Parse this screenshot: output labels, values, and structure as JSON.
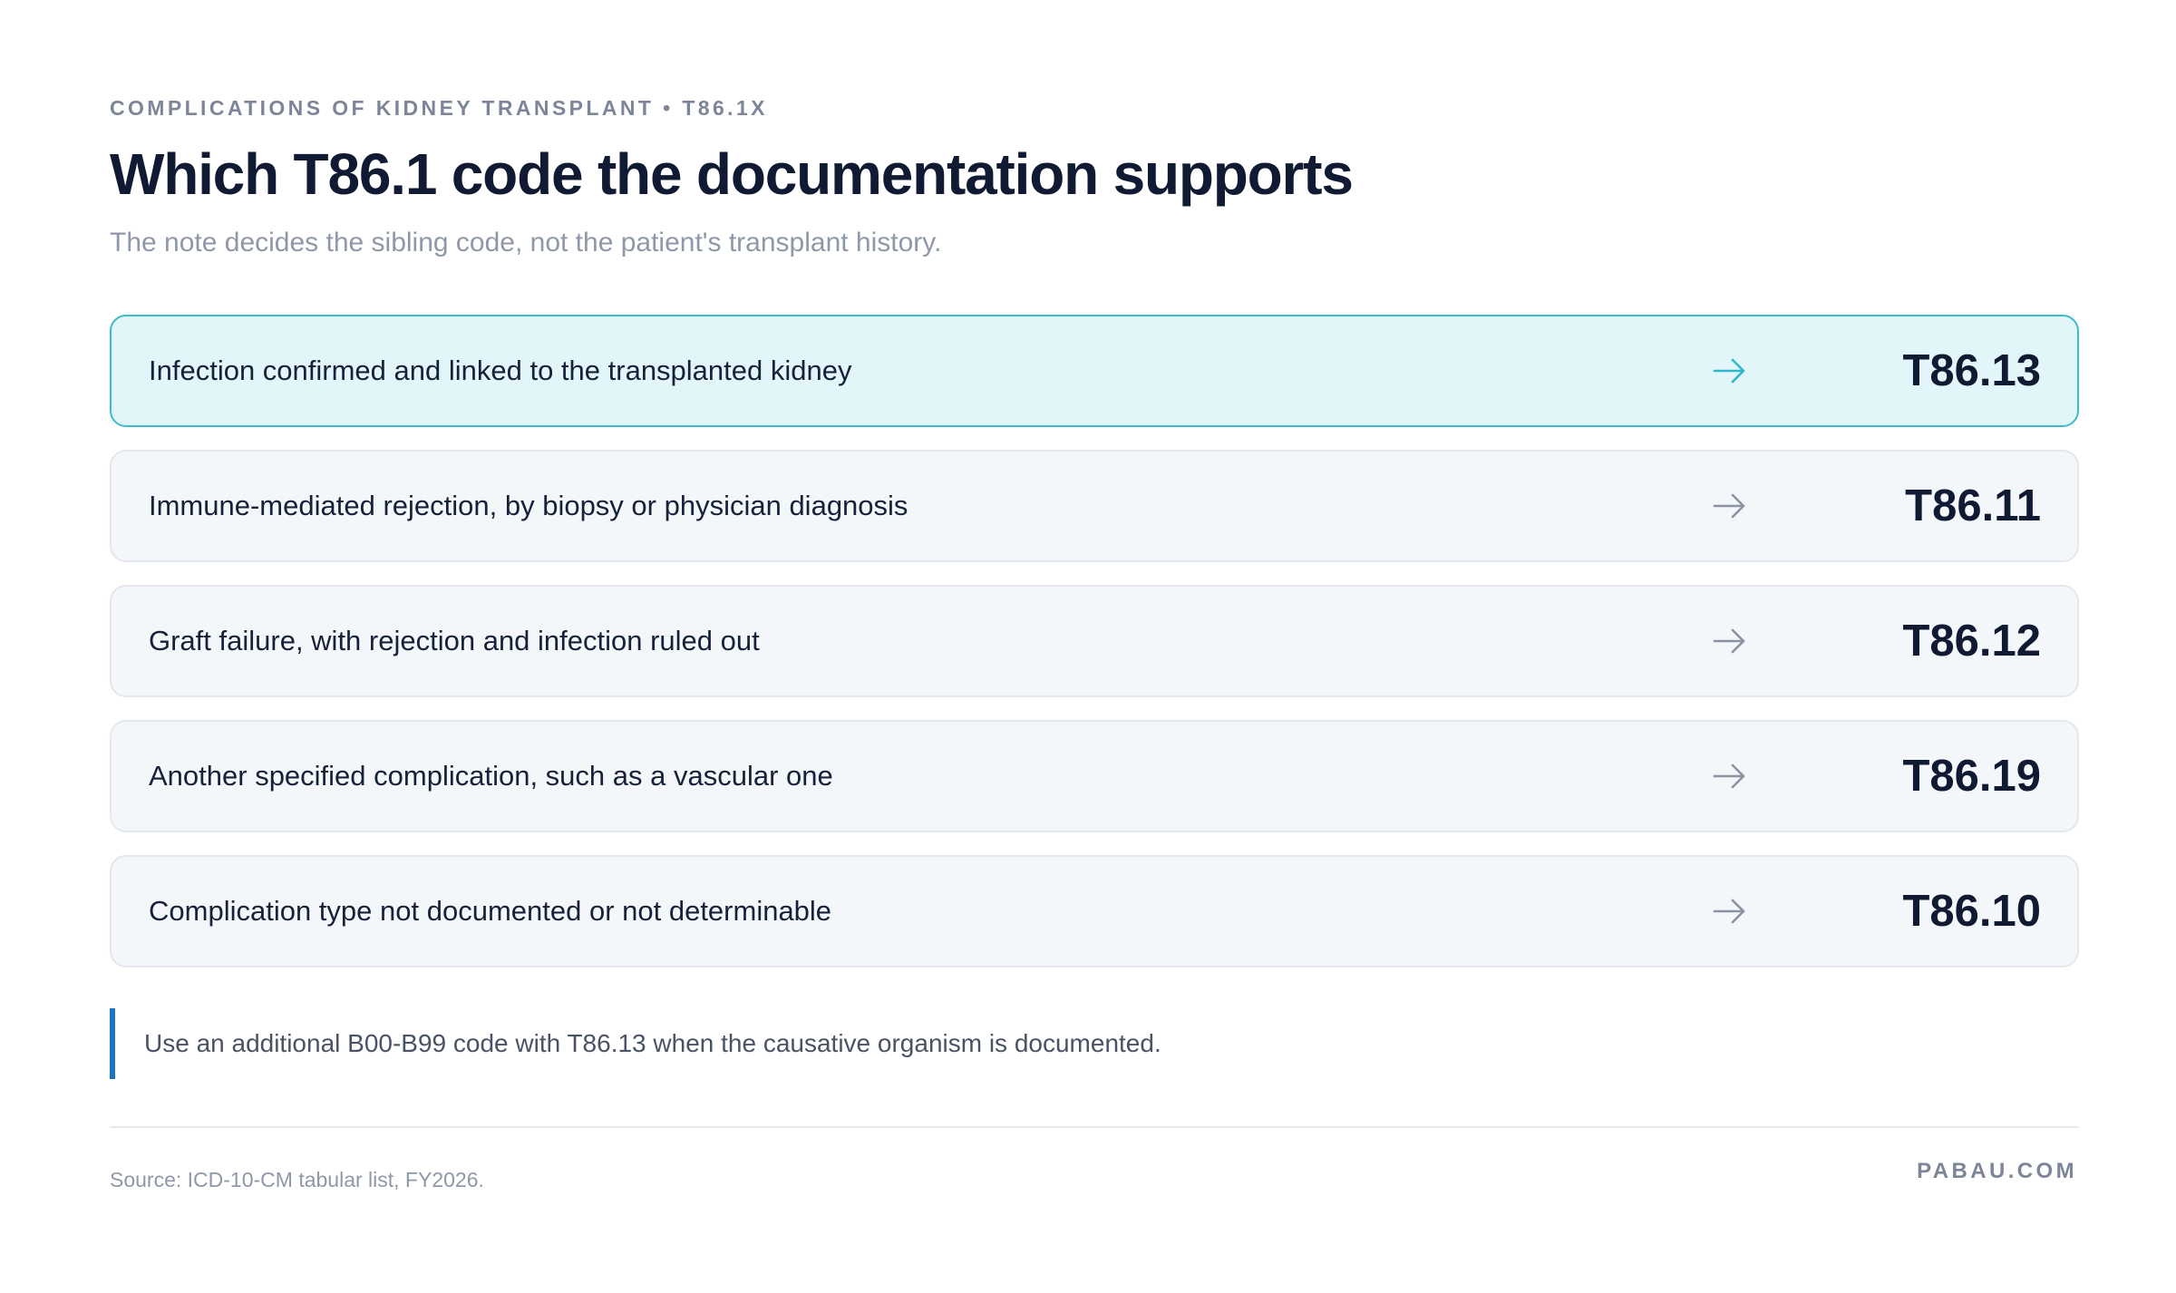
{
  "header": {
    "eyebrow": "COMPLICATIONS OF KIDNEY TRANSPLANT • T86.1X",
    "title": "Which T86.1 code the documentation supports",
    "subtitle": "The note decides the sibling code, not the patient's transplant history."
  },
  "rows": [
    {
      "label": "Infection confirmed and linked to the transplanted kidney",
      "code": "T86.13",
      "highlighted": true
    },
    {
      "label": "Immune-mediated rejection, by biopsy or physician diagnosis",
      "code": "T86.11",
      "highlighted": false
    },
    {
      "label": "Graft failure, with rejection and infection ruled out",
      "code": "T86.12",
      "highlighted": false
    },
    {
      "label": "Another specified complication, such as a vascular one",
      "code": "T86.19",
      "highlighted": false
    },
    {
      "label": "Complication type not documented or not determinable",
      "code": "T86.10",
      "highlighted": false
    }
  ],
  "note": {
    "text": "Use an additional B00-B99 code with T86.13 when the causative organism is documented."
  },
  "footer": {
    "source": "Source: ICD-10-CM tabular list, FY2026.",
    "brand": "PABAU.COM"
  },
  "colors": {
    "highlight_bg": "#e2f6fa",
    "highlight_border": "#3bbccd",
    "highlight_arrow": "#2fb8cc",
    "arrow": "#8a93a3",
    "note_bar": "#1a73c4",
    "title": "#111a33"
  },
  "icons": {
    "row_arrow": "arrow-right-icon"
  }
}
